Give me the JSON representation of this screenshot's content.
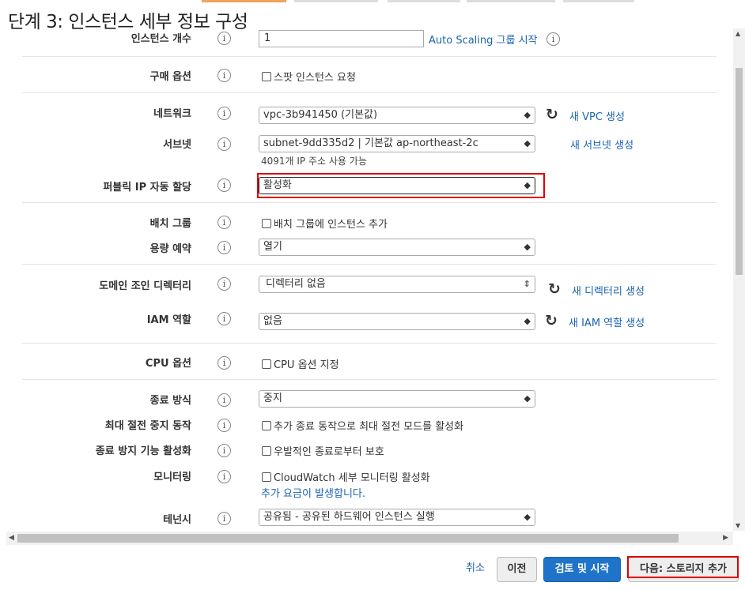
{
  "page": {
    "title": "단계 3: 인스턴스 세부 정보 구성"
  },
  "fields": {
    "instance_count": {
      "label": "인스턴스 개수",
      "value": "1",
      "link": "Auto Scaling 그룹 시작"
    },
    "purchase_option": {
      "label": "구매 옵션",
      "checkbox": "스팟 인스턴스 요청"
    },
    "network": {
      "label": "네트워크",
      "value": "vpc-3b941450 (기본값)",
      "link": "새 VPC 생성"
    },
    "subnet": {
      "label": "서브넷",
      "value": "subnet-9dd335d2 | 기본값 ap-northeast-2c",
      "note": "4091개 IP 주소 사용 가능",
      "link": "새 서브넷 생성"
    },
    "public_ip": {
      "label": "퍼블릭 IP 자동 할당",
      "value": "활성화"
    },
    "placement_group": {
      "label": "배치 그룹",
      "checkbox": "배치 그룹에 인스턴스 추가"
    },
    "capacity_reservation": {
      "label": "용량 예약",
      "value": "열기"
    },
    "domain_join": {
      "label": "도메인 조인 디렉터리",
      "value": "디렉터리 없음",
      "link": "새 디렉터리 생성"
    },
    "iam_role": {
      "label": "IAM 역할",
      "value": "없음",
      "link": "새 IAM 역할 생성"
    },
    "cpu_options": {
      "label": "CPU 옵션",
      "checkbox": "CPU 옵션 지정"
    },
    "shutdown_behavior": {
      "label": "종료 방식",
      "value": "중지"
    },
    "stop_hibernate": {
      "label": "최대 절전 중지 동작",
      "checkbox": "추가 종료 동작으로 최대 절전 모드를 활성화"
    },
    "termination_protection": {
      "label": "종료 방지 기능 활성화",
      "checkbox": "우발적인 종료로부터 보호"
    },
    "monitoring": {
      "label": "모니터링",
      "checkbox": "CloudWatch 세부 모니터링 활성화",
      "note": "추가 요금이 발생합니다."
    },
    "tenancy": {
      "label": "테넌시",
      "value": "공유됨 - 공유된 하드웨어 인스턴스 실행"
    }
  },
  "footer": {
    "cancel": "취소",
    "previous": "이전",
    "review_launch": "검토 및 시작",
    "next": "다음: 스토리지 추가"
  },
  "glyphs": {
    "info": "i",
    "refresh": "↻",
    "select_arrows": "◆",
    "spinner_arrows": "⇕",
    "scroll_up": "▲",
    "scroll_down": "▼",
    "scroll_left": "◀",
    "scroll_right": "▶"
  },
  "colors": {
    "link": "#1b64b0",
    "primary_button": "#1f73c8",
    "highlight": "#e00000",
    "tab_accent": "#f0a35a"
  }
}
